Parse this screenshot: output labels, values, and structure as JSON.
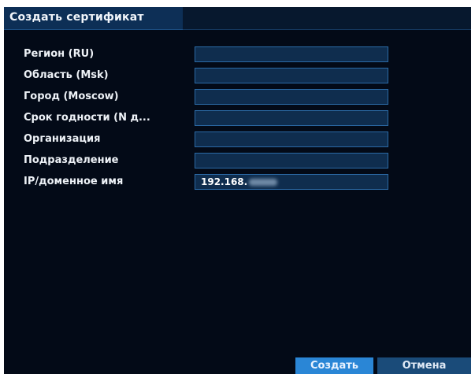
{
  "dialog": {
    "title": "Создать сертификат"
  },
  "fields": [
    {
      "label": "Регион (RU)",
      "value": ""
    },
    {
      "label": "Область (Msk)",
      "value": ""
    },
    {
      "label": "Город (Moscow)",
      "value": ""
    },
    {
      "label": "Срок годности (N д...",
      "value": ""
    },
    {
      "label": "Организация",
      "value": ""
    },
    {
      "label": "Подразделение",
      "value": ""
    },
    {
      "label": "IP/доменное имя",
      "value": "192.168."
    }
  ],
  "buttons": {
    "create_label": "Создать",
    "cancel_label": "Отмена"
  },
  "colors": {
    "background": "#030a17",
    "title_bar": "#0d2f56",
    "field_border": "#2b6aa6",
    "primary_button": "#2a86d6",
    "secondary_button": "#1a4b79"
  }
}
